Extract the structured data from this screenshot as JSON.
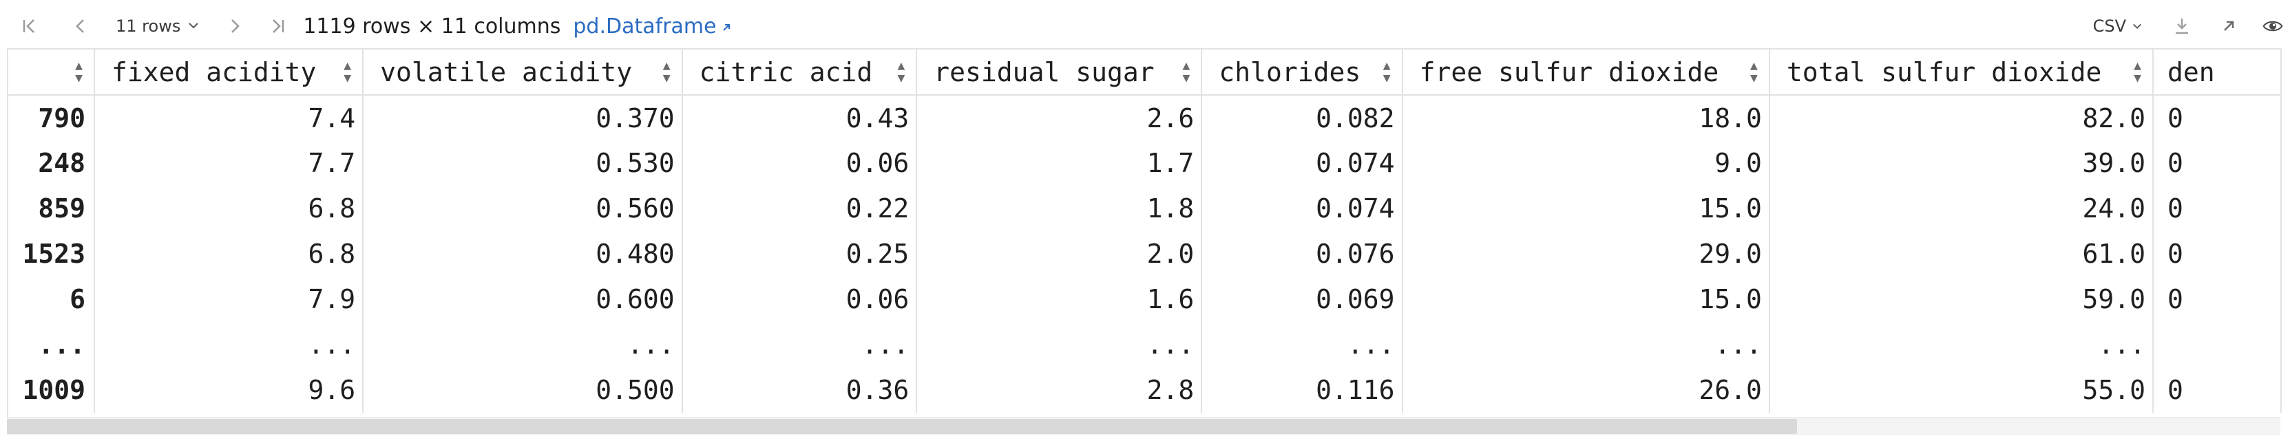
{
  "toolbar": {
    "rows_select": "11 rows",
    "summary": "1119 rows × 11 columns",
    "link": "pd.Dataframe",
    "export_format": "CSV"
  },
  "icons": [
    "first-page-icon",
    "prev-page-icon",
    "chevron-down-icon",
    "next-page-icon",
    "last-page-icon",
    "external-arrow-icon",
    "download-icon",
    "open-icon",
    "eye-icon",
    "sort-icon"
  ],
  "table": {
    "columns": [
      "fixed acidity",
      "volatile acidity",
      "citric acid",
      "residual sugar",
      "chlorides",
      "free sulfur dioxide",
      "total sulfur dioxide",
      "den"
    ],
    "rows": [
      {
        "index": "790",
        "cells": [
          "7.4",
          "0.370",
          "0.43",
          "2.6",
          "0.082",
          "18.0",
          "82.0",
          "0"
        ]
      },
      {
        "index": "248",
        "cells": [
          "7.7",
          "0.530",
          "0.06",
          "1.7",
          "0.074",
          "9.0",
          "39.0",
          "0"
        ]
      },
      {
        "index": "859",
        "cells": [
          "6.8",
          "0.560",
          "0.22",
          "1.8",
          "0.074",
          "15.0",
          "24.0",
          "0"
        ]
      },
      {
        "index": "1523",
        "cells": [
          "6.8",
          "0.480",
          "0.25",
          "2.0",
          "0.076",
          "29.0",
          "61.0",
          "0"
        ]
      },
      {
        "index": "6",
        "cells": [
          "7.9",
          "0.600",
          "0.06",
          "1.6",
          "0.069",
          "15.0",
          "59.0",
          "0"
        ]
      },
      {
        "index": "...",
        "cells": [
          "...",
          "...",
          "...",
          "...",
          "...",
          "...",
          "...",
          ""
        ]
      },
      {
        "index": "1009",
        "cells": [
          "9.6",
          "0.500",
          "0.36",
          "2.8",
          "0.116",
          "26.0",
          "55.0",
          "0"
        ]
      }
    ]
  }
}
